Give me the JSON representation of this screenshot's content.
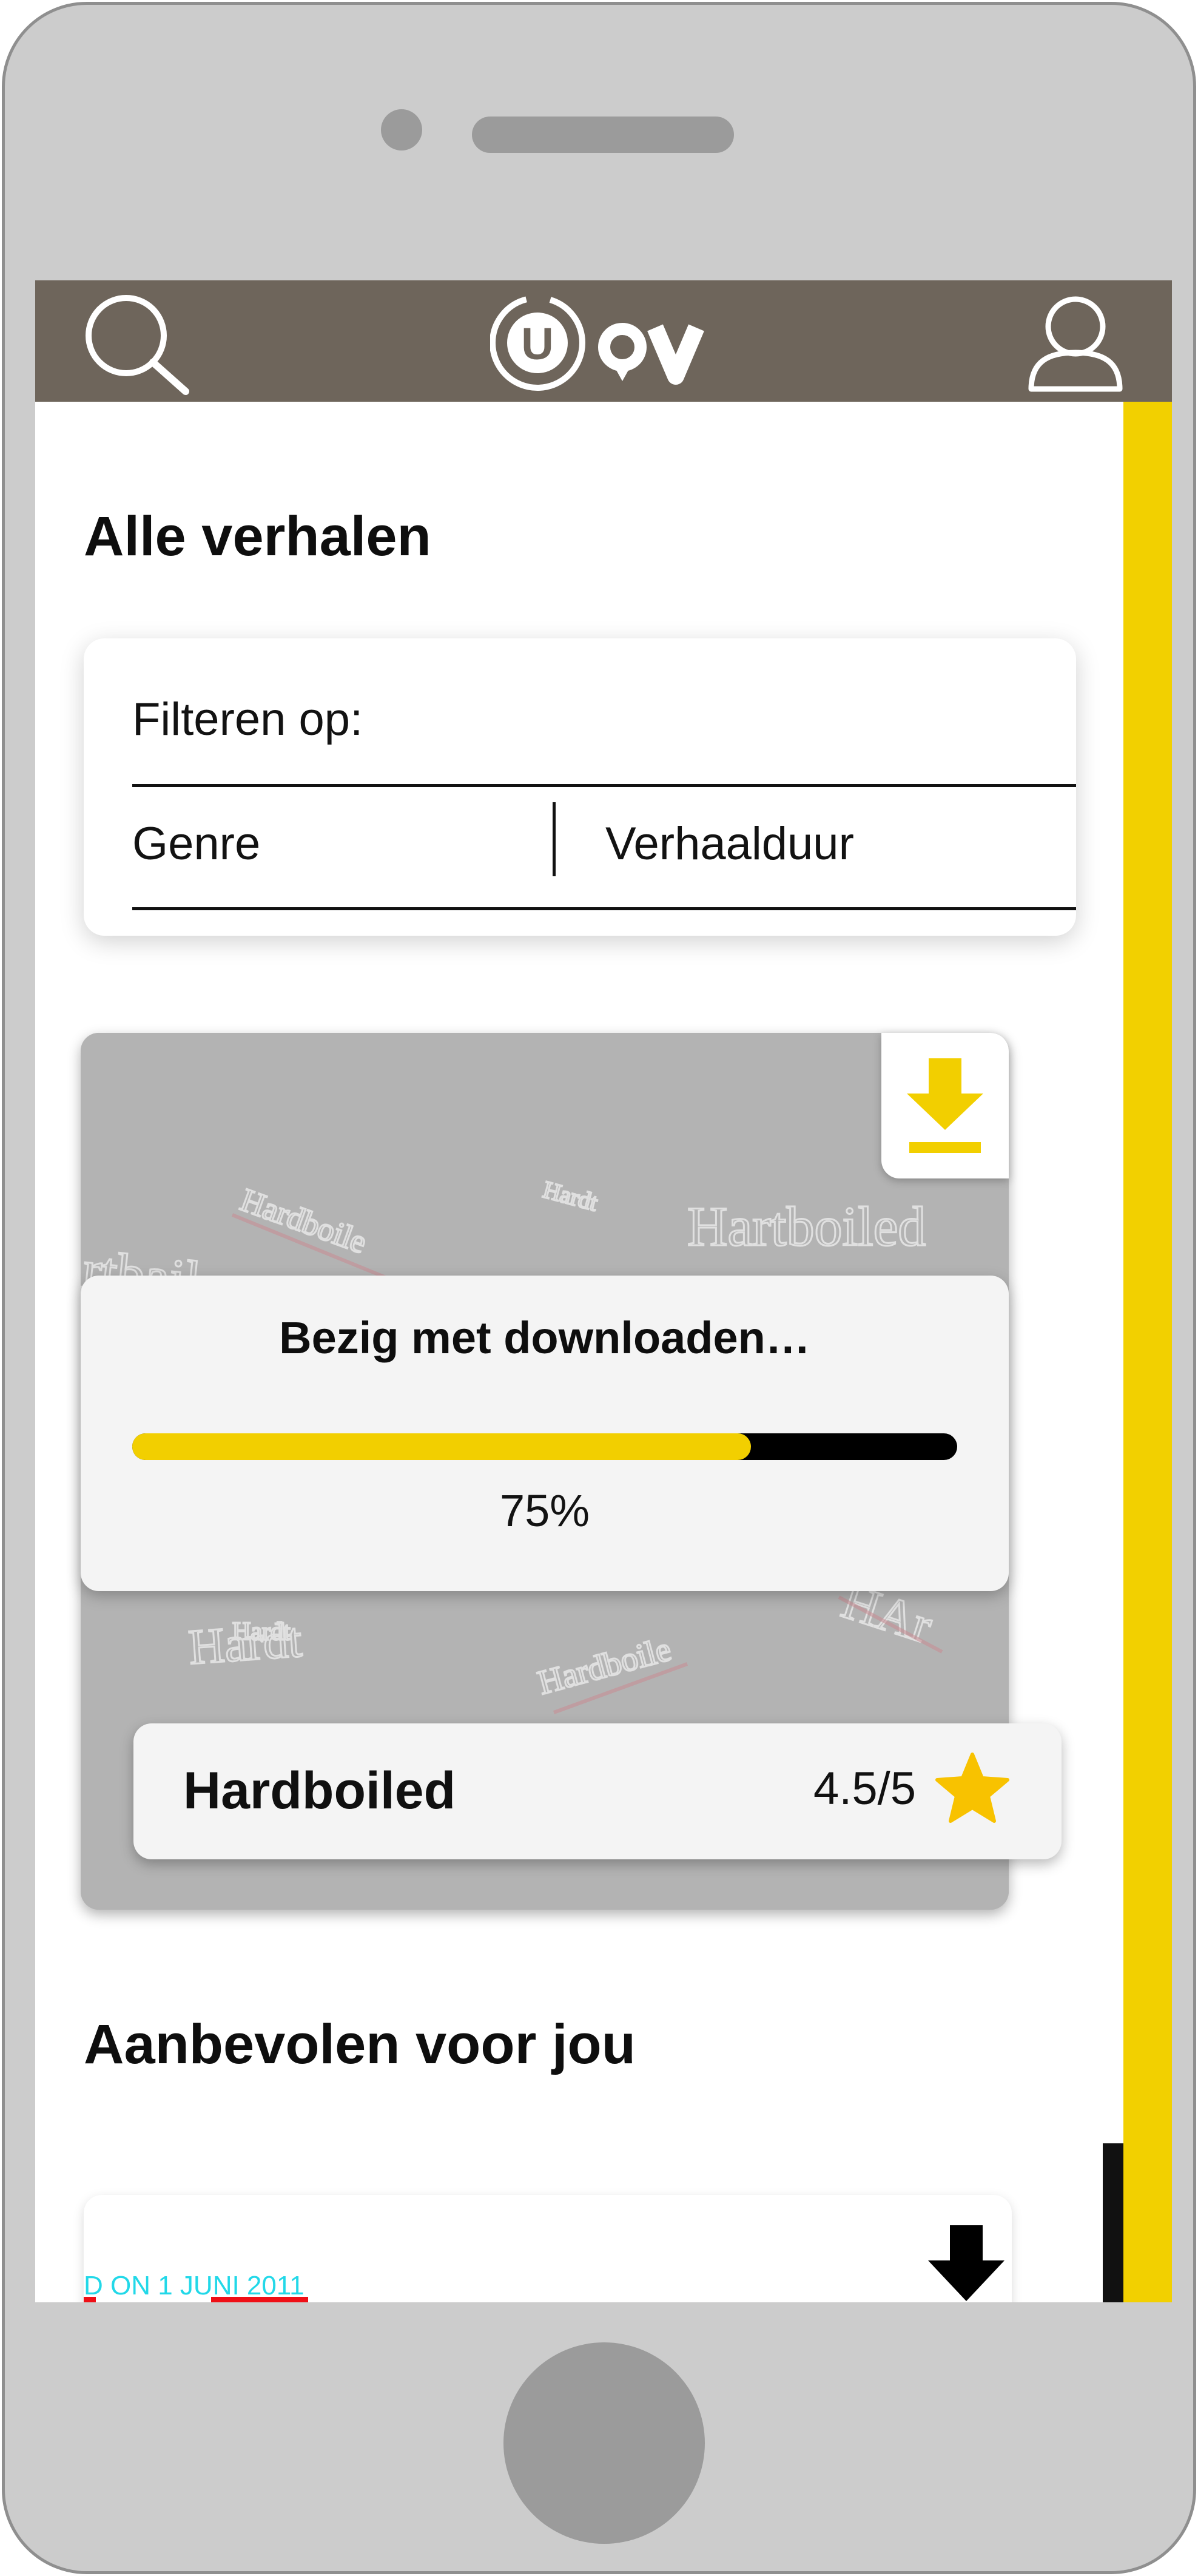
{
  "header": {
    "logo_text": "UOV",
    "search_icon": "search-icon",
    "profile_icon": "user-icon",
    "background_color": "#6e655b"
  },
  "sections": {
    "all_stories_title": "Alle verhalen",
    "recommended_title": "Aanbevolen voor jou"
  },
  "filter": {
    "label": "Filteren op:",
    "genre": "Genre",
    "duration": "Verhaalduur"
  },
  "story_card": {
    "title": "Hardboiled",
    "rating": "4.5/5",
    "download_icon": "download-icon",
    "star_icon": "star-icon",
    "progress": {
      "title": "Bezig met downloaden…",
      "percent_text": "75%",
      "value": 0.75
    }
  },
  "recommended_card": {
    "caption": "D ON 1 JUNI 2011",
    "download_icon": "download-icon"
  },
  "colors": {
    "accent_yellow": "#f2cf00",
    "accent_orange": "#e98a00",
    "topbar": "#6e655b",
    "phone_frame": "#cccccc"
  }
}
